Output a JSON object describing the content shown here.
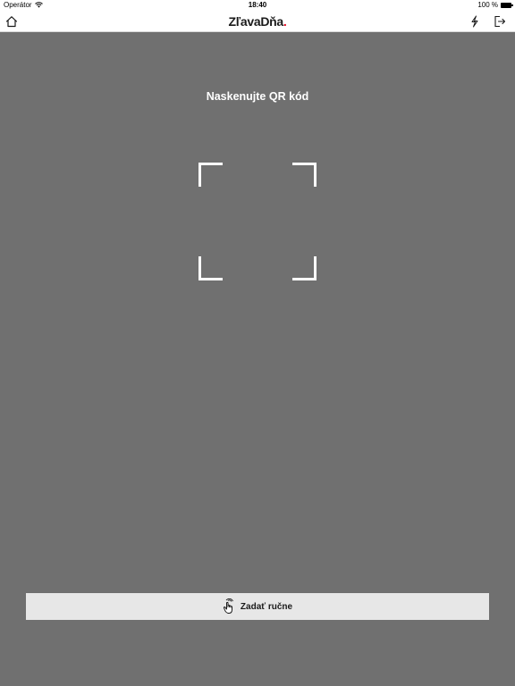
{
  "status_bar": {
    "carrier": "Operátor",
    "time": "18:40",
    "battery_text": "100 %"
  },
  "nav": {
    "title_main": "ZľavaDňa",
    "title_dot": ".",
    "home_icon": "home-icon",
    "flash_icon": "flash-icon",
    "logout_icon": "logout-icon"
  },
  "scanner": {
    "title": "Naskenujte QR kód"
  },
  "manual_entry": {
    "label": "Zadať ručne",
    "icon": "hand-tap-icon"
  },
  "colors": {
    "background": "#707070",
    "accent_dot": "#e2001a",
    "button_bg": "#e7e7e7"
  }
}
